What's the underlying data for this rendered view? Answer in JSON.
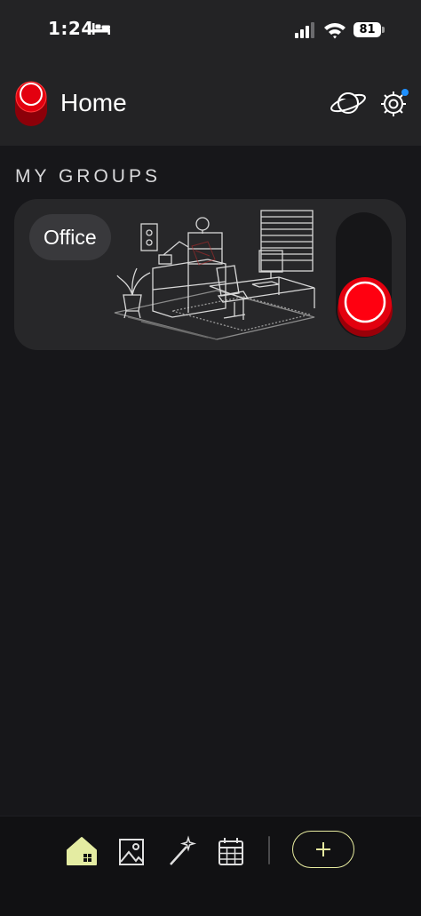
{
  "status_bar": {
    "time": "1:24",
    "battery": "81",
    "icons": [
      "sleep-focus-icon",
      "cellular-signal-icon",
      "wifi-icon",
      "battery-icon"
    ]
  },
  "header": {
    "title": "Home",
    "logo_icon": "red-toggle-logo-icon",
    "actions": [
      "planet-icon",
      "gear-icon"
    ],
    "notification_dot_color": "#1e90ff"
  },
  "groups_section": {
    "title": "MY GROUPS",
    "groups": [
      {
        "name": "Office",
        "illustration": "office-room-illustration",
        "switch_state": "on",
        "switch_color": "#e3000f"
      }
    ]
  },
  "tab_bar": {
    "tabs": [
      {
        "icon": "home-icon",
        "active": true
      },
      {
        "icon": "image-icon",
        "active": false
      },
      {
        "icon": "magic-wand-icon",
        "active": false
      },
      {
        "icon": "calendar-icon",
        "active": false
      }
    ],
    "add_icon": "plus-icon",
    "accent_color": "#e8eca0"
  }
}
